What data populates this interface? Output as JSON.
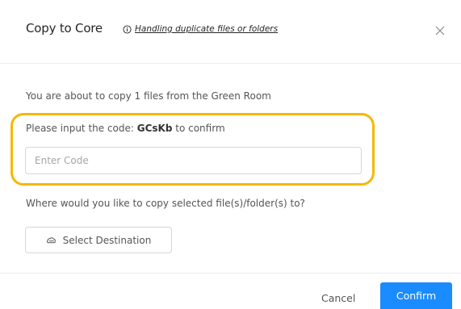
{
  "dialog": {
    "title": "Copy to Core",
    "help_link": "Handling duplicate files or folders",
    "close_icon": "close-icon",
    "info_icon": "info-icon"
  },
  "content": {
    "intro": "You are about to copy 1 files from the Green Room",
    "code_prompt_prefix": "Please input the code: ",
    "code": "GCsKb",
    "code_prompt_suffix": " to confirm",
    "code_input": {
      "value": "",
      "placeholder": "Enter Code"
    },
    "destination_question": "Where would you like to copy selected file(s)/folder(s) to?",
    "destination_button_label": "Select Destination",
    "destination_icon": "cloud-icon"
  },
  "footer": {
    "cancel_label": "Cancel",
    "confirm_label": "Confirm"
  },
  "colors": {
    "primary": "#1a8cff",
    "highlight": "#f5b800"
  }
}
